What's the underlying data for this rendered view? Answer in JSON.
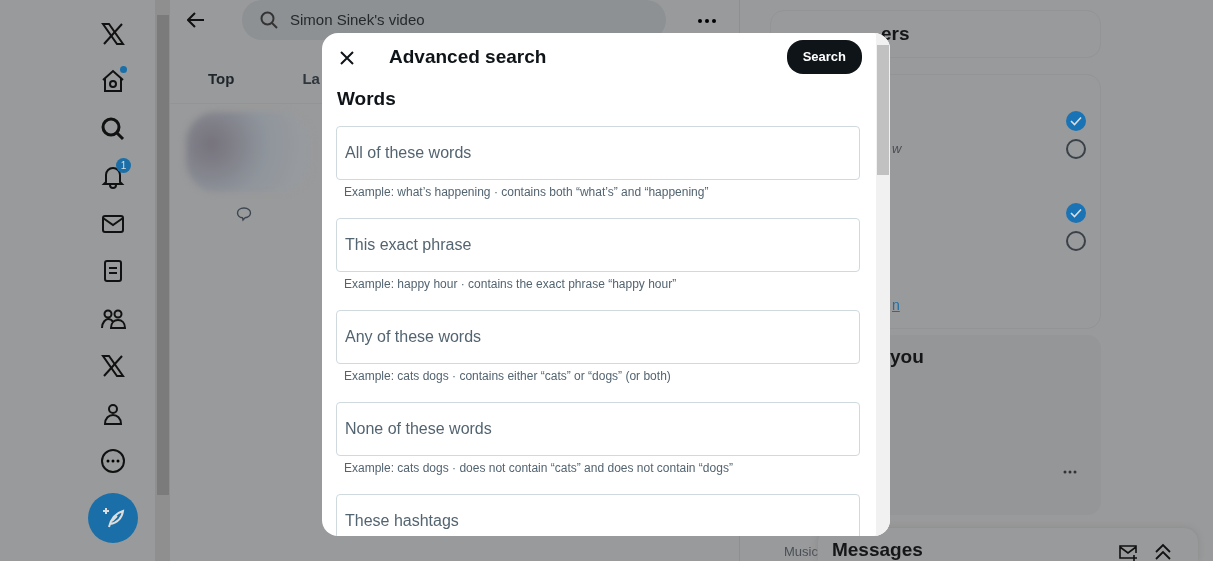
{
  "nav": {
    "items": [
      {
        "kind": "logo"
      },
      {
        "kind": "home",
        "dot": true
      },
      {
        "kind": "search"
      },
      {
        "kind": "notifications",
        "badge": "1"
      },
      {
        "kind": "messages"
      },
      {
        "kind": "lists"
      },
      {
        "kind": "communities"
      },
      {
        "kind": "premium"
      },
      {
        "kind": "profile"
      },
      {
        "kind": "more"
      }
    ]
  },
  "main": {
    "search": {
      "value": "Simon Sinek's video"
    },
    "tabs": [
      {
        "label": "Top",
        "selected": true
      },
      {
        "label": "La",
        "selected": false
      }
    ]
  },
  "right_panel": {
    "filters_title": "ers",
    "groups": [
      {
        "options": [
          {
            "checked": true
          },
          {
            "checked": false,
            "label": "w"
          }
        ]
      },
      {
        "options": [
          {
            "checked": true
          },
          {
            "checked": false
          }
        ]
      }
    ],
    "link": "n",
    "follow_title": "you",
    "music_label": "Music",
    "messages_title": "Messages"
  },
  "modal": {
    "title": "Advanced search",
    "search_button": "Search",
    "section": "Words",
    "fields": [
      {
        "placeholder": "All of these words",
        "hint": "Example: what’s happening · contains both “what’s” and “happening”"
      },
      {
        "placeholder": "This exact phrase",
        "hint": "Example: happy hour · contains the exact phrase “happy hour”"
      },
      {
        "placeholder": "Any of these words",
        "hint": "Example: cats dogs · contains either “cats” or “dogs” (or both)"
      },
      {
        "placeholder": "None of these words",
        "hint": "Example: cats dogs · does not contain “cats” and does not contain “dogs”"
      },
      {
        "placeholder": "These hashtags"
      }
    ]
  }
}
